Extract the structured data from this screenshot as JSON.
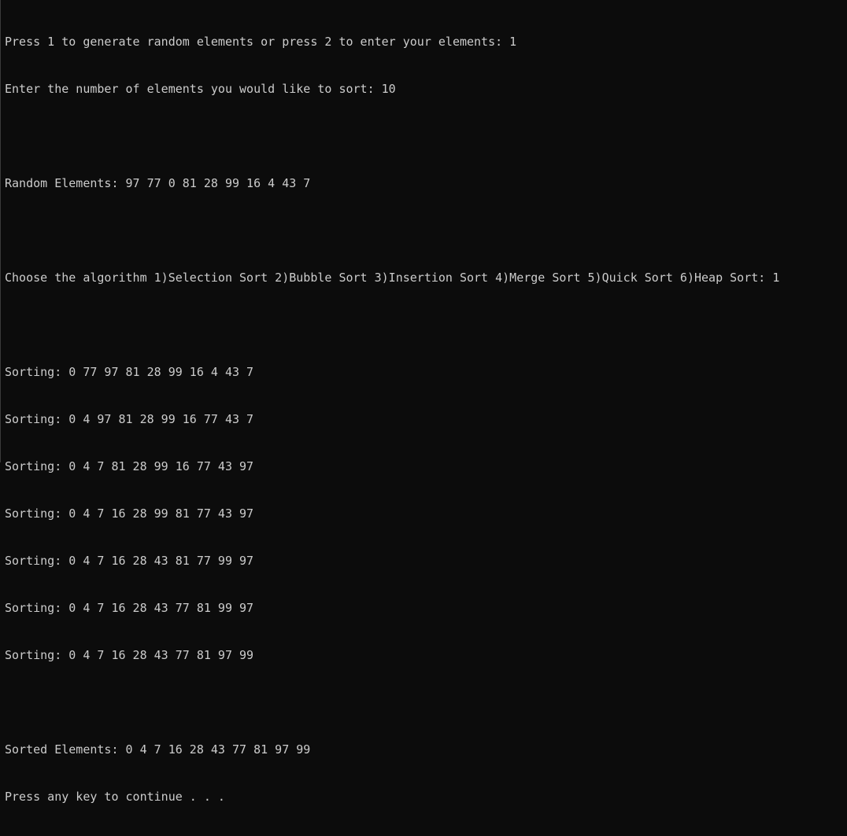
{
  "console": {
    "lines": [
      "Press 1 to generate random elements or press 2 to enter your elements: 1",
      "Enter the number of elements you would like to sort: 10",
      "",
      "Random Elements: 97 77 0 81 28 99 16 4 43 7",
      "",
      "Choose the algorithm 1)Selection Sort 2)Bubble Sort 3)Insertion Sort 4)Merge Sort 5)Quick Sort 6)Heap Sort: 1",
      "",
      "Sorting: 0 77 97 81 28 99 16 4 43 7",
      "Sorting: 0 4 97 81 28 99 16 77 43 7",
      "Sorting: 0 4 7 81 28 99 16 77 43 97",
      "Sorting: 0 4 7 16 28 99 81 77 43 97",
      "Sorting: 0 4 7 16 28 43 81 77 99 97",
      "Sorting: 0 4 7 16 28 43 77 81 99 97",
      "Sorting: 0 4 7 16 28 43 77 81 97 99",
      "",
      "Sorted Elements: 0 4 7 16 28 43 77 81 97 99",
      "Press any key to continue . . ."
    ]
  },
  "colors": {
    "background": "#0c0c0c",
    "text": "#cccccc"
  }
}
